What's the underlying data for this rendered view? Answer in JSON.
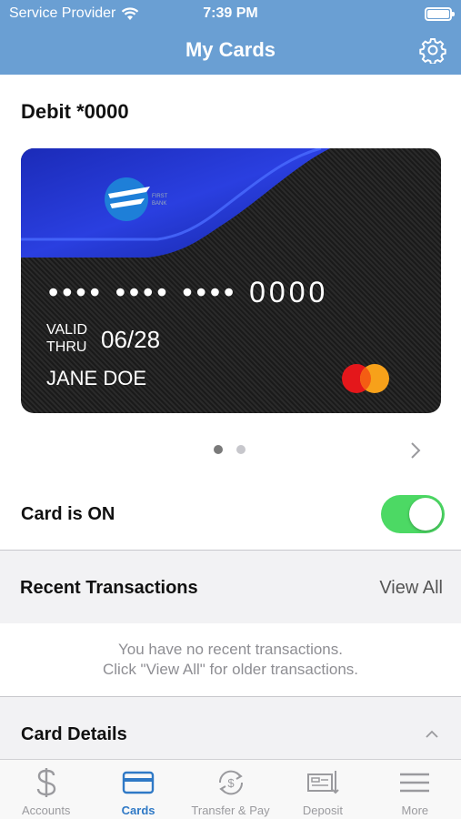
{
  "status_bar": {
    "carrier": "Service Provider",
    "time": "7:39 PM"
  },
  "header": {
    "title": "My Cards",
    "settings_icon": "gear-icon"
  },
  "card": {
    "label": "Debit *0000",
    "masked_number": "•••• •••• •••• 0000",
    "valid_thru_label": "VALID\nTHRU",
    "expiry": "06/28",
    "holder": "JANE DOE",
    "network_icon": "mastercard-logo",
    "page_count": 2,
    "active_page": 1
  },
  "card_status": {
    "label": "Card is ON",
    "on": true
  },
  "recent_transactions": {
    "title": "Recent Transactions",
    "view_all": "View All",
    "empty_line1": "You have no recent transactions.",
    "empty_line2": "Click \"View All\" for older transactions."
  },
  "card_details": {
    "title": "Card Details"
  },
  "tabs": [
    {
      "label": "Accounts",
      "icon": "dollar-icon",
      "active": false
    },
    {
      "label": "Cards",
      "icon": "card-icon",
      "active": true
    },
    {
      "label": "Transfer & Pay",
      "icon": "transfer-icon",
      "active": false
    },
    {
      "label": "Deposit",
      "icon": "deposit-check-icon",
      "active": false
    },
    {
      "label": "More",
      "icon": "menu-icon",
      "active": false
    }
  ],
  "colors": {
    "header": "#6a9fd3",
    "accent": "#2f79c6",
    "switch_on": "#4cd964"
  }
}
